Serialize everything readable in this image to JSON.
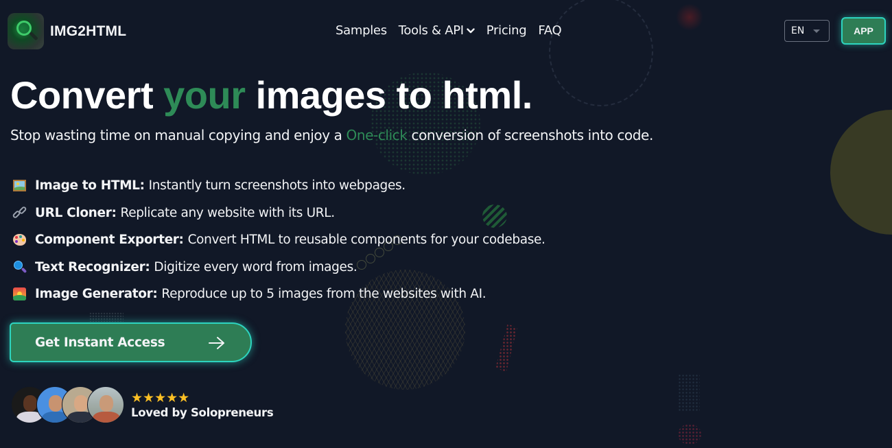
{
  "brand": {
    "name": "IMG2HTML",
    "logo_icon": "magnifier-logo-icon"
  },
  "nav": {
    "items": [
      {
        "label": "Samples",
        "has_dropdown": false
      },
      {
        "label": "Tools & API",
        "has_dropdown": true
      },
      {
        "label": "Pricing",
        "has_dropdown": false
      },
      {
        "label": "FAQ",
        "has_dropdown": false
      }
    ],
    "language": {
      "selected": "EN"
    },
    "app_button": "APP"
  },
  "hero": {
    "title_parts": [
      "Convert ",
      "your",
      " images to html."
    ],
    "subtitle_parts": [
      "Stop wasting time on manual copying and enjoy a ",
      "One-click",
      " conversion of screenshots into code."
    ],
    "accent_color": "#2e8b57"
  },
  "features": [
    {
      "icon": "framed-picture-icon",
      "title": "Image to HTML:",
      "text": "Instantly turn screenshots into webpages."
    },
    {
      "icon": "link-icon",
      "title": "URL Cloner:",
      "text": "Replicate any website with its URL."
    },
    {
      "icon": "palette-icon",
      "title": "Component Exporter:",
      "text": "Convert HTML to reusable components for your codebase."
    },
    {
      "icon": "magnifying-glass-icon",
      "title": "Text Recognizer:",
      "text": "Digitize every word from images."
    },
    {
      "icon": "sunrise-icon",
      "title": "Image Generator:",
      "text": "Reproduce up to 5 images from the websites with AI."
    }
  ],
  "cta": {
    "label": "Get Instant Access",
    "icon": "arrow-right-icon",
    "color": "#2e7d55",
    "glow_color": "#2dd4bf"
  },
  "social_proof": {
    "avatar_count": 4,
    "stars": "★★★★★",
    "rating": 5,
    "rating_max": 5,
    "caption": "Loved by Solopreneurs"
  }
}
